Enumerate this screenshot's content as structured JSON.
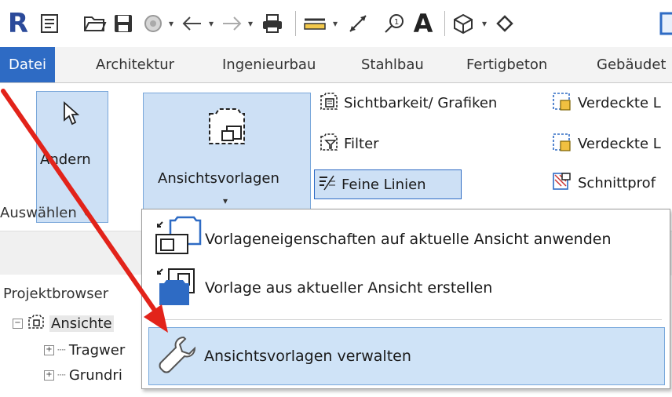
{
  "colors": {
    "accent": "#2e6bc4",
    "selection": "#cfe3f7",
    "selection_border": "#77a8dc",
    "arrow": "#e2231a",
    "revit_logo": "#2b4a9a"
  },
  "qat": {
    "logo": "R",
    "icons": [
      "revit-logo",
      "info-icon",
      "open-folder-icon",
      "save-icon",
      "sync-icon",
      "undo-icon",
      "redo-icon",
      "print-icon",
      "measure-icon",
      "aligned-dimension-icon",
      "tag-icon",
      "text-icon",
      "3d-view-icon",
      "section-icon"
    ]
  },
  "tabs": [
    "Datei",
    "Architektur",
    "Ingenieurbau",
    "Stahlbau",
    "Fertigbeton",
    "Gebäudet"
  ],
  "ribbon": {
    "modify_label": "Ändern",
    "select_label": "Auswählen",
    "view_templates_label": "Ansichtsvorlagen",
    "visibility_label": "Sichtbarkeit/ Grafiken",
    "filter_label": "Filter",
    "thin_lines_label": "Feine Linien",
    "hidden_lines_1": "Verdeckte L",
    "hidden_lines_2": "Verdeckte L",
    "section_profile": "Schnittprof"
  },
  "browser": {
    "title": "Projektbrowser",
    "root": "Ansichte",
    "child1": "Tragwer",
    "child2": "Grundri"
  },
  "menu": {
    "items": [
      {
        "label": "Vorlageneigenschaften auf aktuelle Ansicht anwenden",
        "icon": "apply-template-icon"
      },
      {
        "label": "Vorlage aus aktueller Ansicht erstellen",
        "icon": "create-template-icon"
      },
      {
        "label": "Ansichtsvorlagen verwalten",
        "icon": "wrench-icon"
      }
    ],
    "selected_index": 2
  }
}
